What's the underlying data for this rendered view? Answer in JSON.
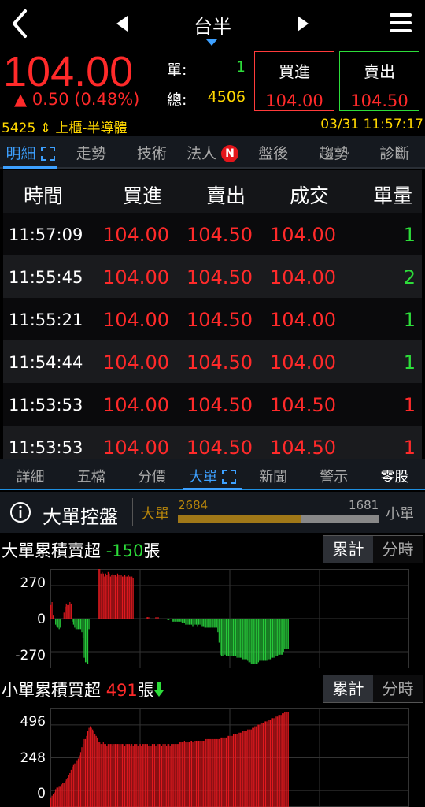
{
  "header": {
    "title": "台半",
    "back_icon": "back-chevron-icon",
    "prev_icon": "triangle-left-icon",
    "next_icon": "triangle-right-icon",
    "menu_icon": "hamburger-menu-icon"
  },
  "quote": {
    "price": "104.00",
    "change": "▲ 0.50 (0.48%)",
    "single_label": "單:",
    "single_value": "1",
    "total_label": "總:",
    "total_value": "4506",
    "buy_label": "買進",
    "buy_price": "104.00",
    "sell_label": "賣出",
    "sell_price": "104.50"
  },
  "info": {
    "code_market": "5425 ⇕ 上櫃-半導體",
    "datetime": "03/31 11:57:17"
  },
  "tabs_top": [
    {
      "label": "明細",
      "active": true
    },
    {
      "label": "走勢"
    },
    {
      "label": "技術"
    },
    {
      "label": "法人",
      "badge": "N"
    },
    {
      "label": "盤後"
    },
    {
      "label": "趨勢"
    },
    {
      "label": "診斷"
    }
  ],
  "details": {
    "headers": [
      "時間",
      "買進",
      "賣出",
      "成交",
      "單量"
    ],
    "rows": [
      {
        "time": "11:57:09",
        "buy": "104.00",
        "sell": "104.50",
        "deal": "104.00",
        "vol": "1",
        "vol_color": "#2ddd3a"
      },
      {
        "time": "11:55:45",
        "buy": "104.00",
        "sell": "104.50",
        "deal": "104.00",
        "vol": "2",
        "vol_color": "#2ddd3a"
      },
      {
        "time": "11:55:21",
        "buy": "104.00",
        "sell": "104.50",
        "deal": "104.00",
        "vol": "1",
        "vol_color": "#2ddd3a"
      },
      {
        "time": "11:54:44",
        "buy": "104.00",
        "sell": "104.50",
        "deal": "104.00",
        "vol": "1",
        "vol_color": "#2ddd3a"
      },
      {
        "time": "11:53:53",
        "buy": "104.00",
        "sell": "104.50",
        "deal": "104.50",
        "vol": "1",
        "vol_color": "#ff2a2a"
      },
      {
        "time": "11:53:53",
        "buy": "104.00",
        "sell": "104.50",
        "deal": "104.50",
        "vol": "1",
        "vol_color": "#ff2a2a"
      }
    ]
  },
  "tabs_bottom": [
    {
      "label": "詳細"
    },
    {
      "label": "五檔"
    },
    {
      "label": "分價"
    },
    {
      "label": "大單",
      "active": true
    },
    {
      "label": "新聞"
    },
    {
      "label": "警示"
    },
    {
      "label": "零股",
      "white": true
    }
  ],
  "big_order": {
    "info_icon": "info-circle-icon",
    "title": "大單控盤",
    "left_label": "大單",
    "right_label": "小單",
    "left_value": "2684",
    "right_value": "1681",
    "ratio": 0.615
  },
  "section_big": {
    "title_prefix": "大單累積賣超 ",
    "title_value": "-150",
    "title_suffix": "張",
    "seg_on": "累計",
    "seg_off": "分時"
  },
  "section_small": {
    "title_prefix": "小單累積買超 ",
    "title_value": "491",
    "title_suffix": "張",
    "arrow_icon": "green-down-arrow-icon",
    "seg_on": "累計",
    "seg_off": "分時"
  },
  "colors": {
    "up": "#ff2a2a",
    "down": "#2ddd3a",
    "accent": "#3da0ff",
    "highlight": "#ffd700"
  },
  "chart_data": [
    {
      "type": "bar",
      "yticks": [
        "270",
        "0",
        "-270"
      ],
      "ylim": [
        -330,
        330
      ],
      "series": [
        {
          "values": [
            90,
            110,
            20,
            0,
            -40,
            -50,
            -60,
            -70,
            -60,
            0,
            0,
            40,
            80,
            100,
            90,
            90,
            110,
            100,
            -20,
            -40,
            -60,
            -70,
            -70,
            -70,
            -70,
            -70,
            -90,
            -130,
            -260,
            -290,
            -290,
            -300,
            -70,
            0,
            0,
            0,
            0,
            0,
            0,
            0,
            330,
            340,
            300,
            310,
            300,
            280,
            300,
            290,
            310,
            300,
            280,
            290,
            300,
            290,
            290,
            280,
            300,
            290,
            280,
            290,
            280,
            280,
            290,
            280,
            280,
            290,
            280,
            280,
            280,
            270,
            0,
            0,
            0,
            0,
            0,
            0,
            0,
            0,
            0,
            0,
            10,
            10,
            10,
            0,
            0,
            0,
            0,
            0,
            10,
            10,
            10,
            0,
            0,
            0,
            0,
            0,
            0,
            0,
            -10,
            -10,
            0,
            0,
            -20,
            -20,
            -20,
            -20,
            -20,
            -20,
            -20,
            -20,
            -30,
            -30,
            -30,
            -40,
            -40,
            -40,
            -40,
            -40,
            -40,
            -50,
            -40,
            -40,
            -40,
            -50,
            -40,
            -40,
            -50,
            -50,
            -50,
            -60,
            -60,
            -60,
            -60,
            -60,
            -60,
            -60,
            -60,
            -60,
            -60,
            -60,
            -90,
            -160,
            -240,
            -250,
            -250,
            -250,
            -240,
            -250,
            -250,
            -250,
            -250,
            -250,
            -250,
            -250,
            -250,
            -250,
            -260,
            -260,
            -260,
            -260,
            -260,
            -270,
            -270,
            -270,
            -270,
            -280,
            -290,
            -290,
            -300,
            -300,
            -300,
            -300,
            -300,
            -300,
            -290,
            -280,
            -280,
            -280,
            -280,
            -280,
            -280,
            -280,
            -270,
            -270,
            -270,
            -260,
            -260,
            -260,
            -250,
            -250,
            -250,
            -240,
            -240,
            -240,
            -240,
            -220,
            -200,
            -200,
            -200,
            -200
          ]
        }
      ]
    },
    {
      "type": "bar",
      "yticks": [
        "496",
        "248",
        "0"
      ],
      "ylim": [
        0,
        610
      ],
      "series": [
        {
          "values": [
            60,
            70,
            80,
            90,
            110,
            120,
            120,
            130,
            130,
            140,
            150,
            150,
            160,
            170,
            180,
            200,
            210,
            230,
            250,
            260,
            270,
            270,
            290,
            300,
            320,
            340,
            370,
            390,
            420,
            420,
            440,
            470,
            490,
            500,
            490,
            480,
            470,
            450,
            440,
            430,
            400,
            400,
            390,
            390,
            400,
            390,
            390,
            380,
            390,
            390,
            390,
            390,
            380,
            390,
            390,
            390,
            390,
            390,
            380,
            390,
            390,
            390,
            380,
            390,
            390,
            390,
            390,
            380,
            390,
            380,
            390,
            390,
            390,
            380,
            390,
            390,
            380,
            390,
            390,
            390,
            390,
            390,
            380,
            390,
            380,
            390,
            390,
            390,
            380,
            390,
            390,
            390,
            390,
            380,
            390,
            390,
            390,
            380,
            390,
            390,
            380,
            390,
            390,
            390,
            390,
            390,
            390,
            390,
            400,
            400,
            400,
            400,
            410,
            400,
            400,
            400,
            400,
            410,
            410,
            400,
            410,
            410,
            410,
            410,
            410,
            410,
            410,
            410,
            410,
            410,
            420,
            420,
            420,
            420,
            420,
            420,
            420,
            420,
            420,
            420,
            420,
            420,
            430,
            430,
            430,
            430,
            430,
            430,
            440,
            440,
            440,
            440,
            440,
            450,
            450,
            450,
            450,
            460,
            460,
            460,
            460,
            470,
            470,
            470,
            470,
            480,
            480,
            480,
            480,
            490,
            490,
            500,
            500,
            510,
            510,
            510,
            520,
            520,
            520,
            530,
            530,
            530,
            540,
            540,
            540,
            550,
            550,
            550,
            560,
            560,
            560,
            570,
            570,
            570,
            580,
            580,
            590,
            590,
            590,
            590
          ]
        }
      ]
    }
  ]
}
